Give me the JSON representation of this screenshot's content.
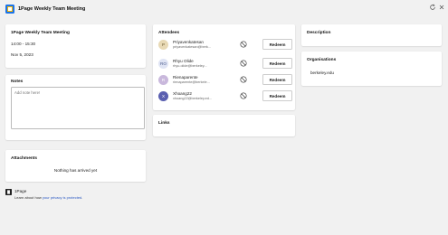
{
  "header": {
    "title": "1Page Weekly Team Meeting",
    "refresh_icon": "refresh-icon",
    "close_icon": "close-icon"
  },
  "meeting": {
    "card_title": "1Page Weekly Team Meeting",
    "time": "14:00 - 15:30",
    "date": "Nov 5, 2023"
  },
  "notes": {
    "title": "Notes",
    "placeholder": "Add note here!"
  },
  "attachments": {
    "title": "Attachments",
    "empty_text": "Nothing has arrived yet"
  },
  "attendees": {
    "title": "Attendees",
    "items": [
      {
        "initials": "P",
        "name": "Priyavenkatesan",
        "email": "priyavenkatesan@berk...",
        "avatar_bg": "#e8d9b5",
        "avatar_fg": "#6b5a2e",
        "action": "Redeem"
      },
      {
        "initials": "RO",
        "name": "Rhyu Olide",
        "email": "rhyu.olide@berkeley...",
        "avatar_bg": "#dfe4f4",
        "avatar_fg": "#4b5a8a",
        "action": "Redeem"
      },
      {
        "initials": "R",
        "name": "Rienaparente",
        "email": "rienaparente@berkele...",
        "avatar_bg": "#c9b8dc",
        "avatar_fg": "#ffffff",
        "action": "Redeem"
      },
      {
        "initials": "X",
        "name": "Xhoang22",
        "email": "xhoang22@berkeley.ed...",
        "avatar_bg": "#5a5fb0",
        "avatar_fg": "#ffffff",
        "action": "Redeem"
      }
    ]
  },
  "links": {
    "title": "Links"
  },
  "description": {
    "title": "Description"
  },
  "organisations": {
    "title": "Organisations",
    "items": [
      "berkeley.edu"
    ]
  },
  "footer": {
    "title": "1Page",
    "text_prefix": "Learn about how ",
    "link_text": "your privacy is protected",
    "text_suffix": "."
  },
  "colors": {
    "background": "#f1f1f1",
    "card": "#ffffff",
    "link": "#2b59c3",
    "logo_blue": "#1a73e8",
    "logo_yellow": "#f4b400"
  }
}
